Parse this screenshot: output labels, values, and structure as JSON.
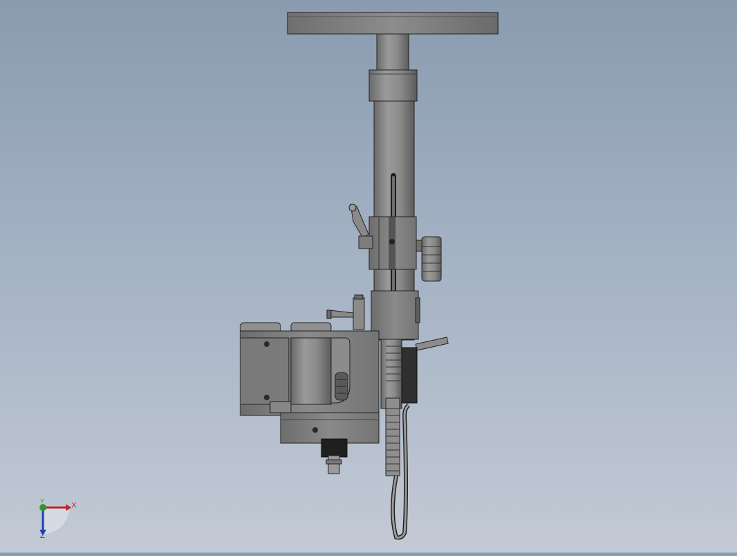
{
  "triad": {
    "x_label": "X",
    "y_label": "Y",
    "z_label": "Z",
    "x_color": "#c0262a",
    "y_color": "#2a9a2f",
    "z_color": "#1f3fb8"
  },
  "model": {
    "base_color": "#7d7d7d",
    "dark_color": "#2b2b2b",
    "edge_color": "#1a1a1a"
  }
}
